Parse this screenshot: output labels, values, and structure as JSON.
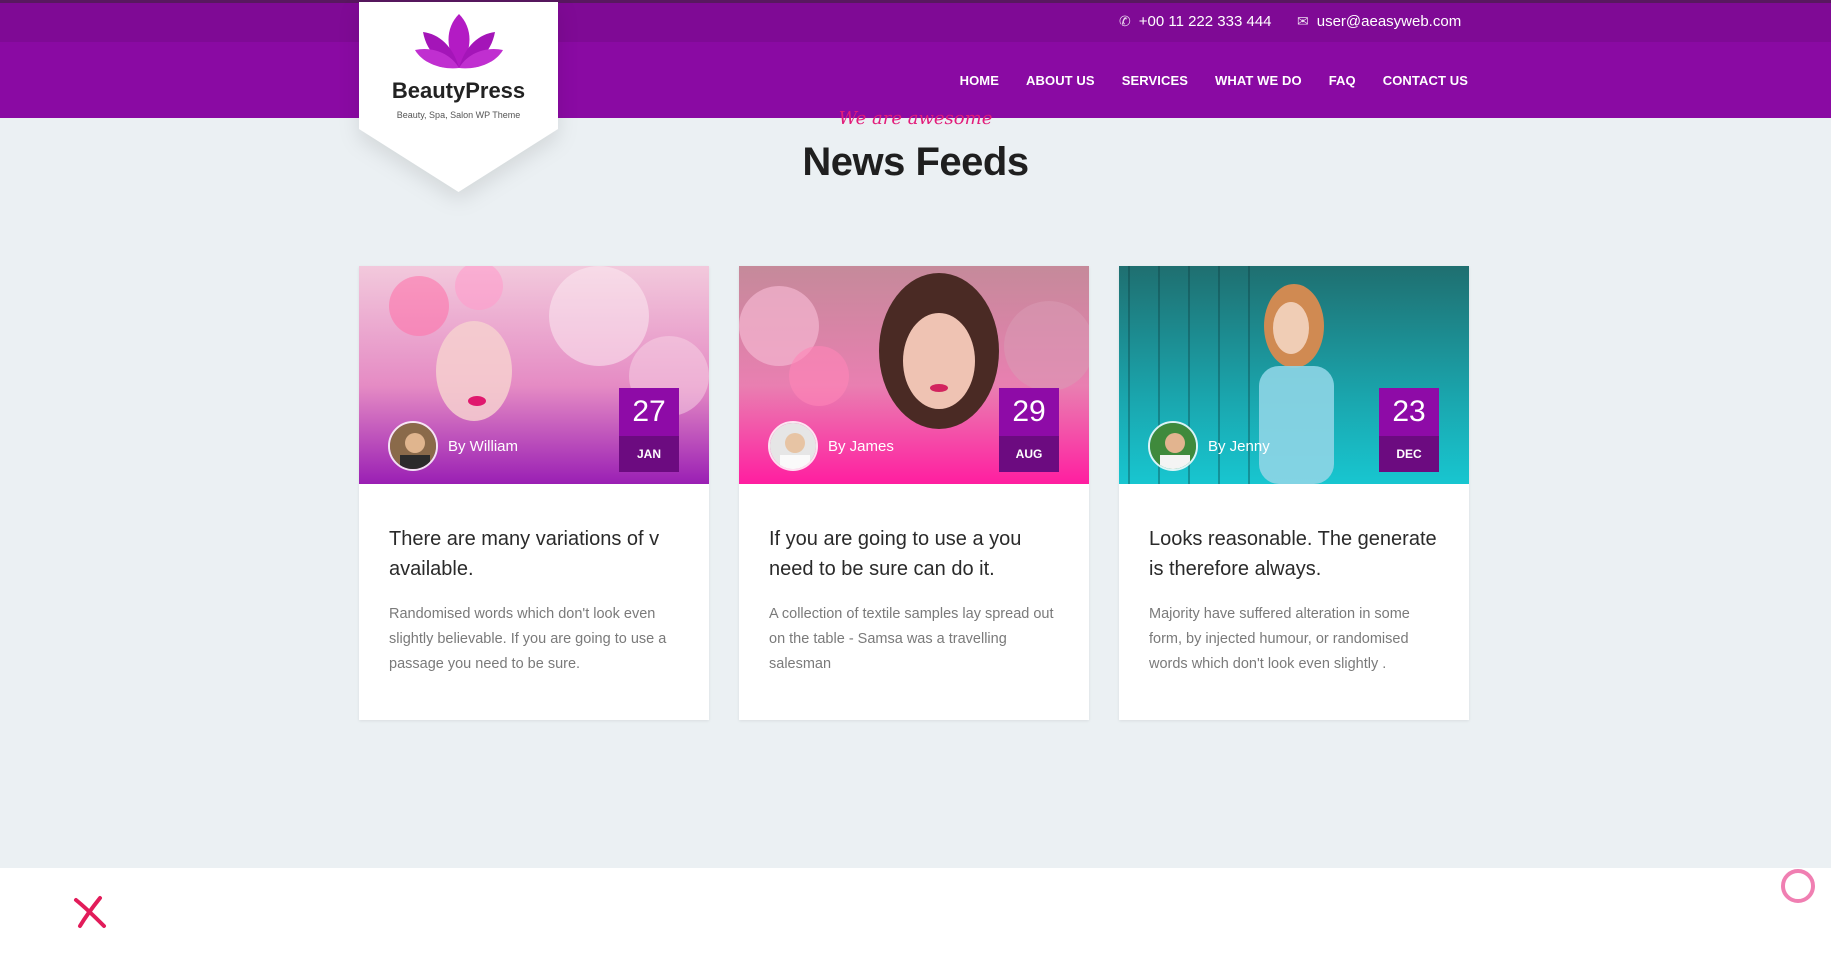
{
  "header": {
    "phone": "+00 11 222 333 444",
    "email": "user@aeasyweb.com",
    "nav": [
      "HOME",
      "ABOUT US",
      "SERVICES",
      "WHAT WE DO",
      "FAQ",
      "CONTACT US"
    ]
  },
  "logo": {
    "title": "BeautyPress",
    "subtitle": "Beauty, Spa, Salon WP Theme"
  },
  "section": {
    "tagline": "We are awesome",
    "title": "News Feeds"
  },
  "posts": [
    {
      "author": "By William",
      "day": "27",
      "month": "JAN",
      "title": "There are many variations of v available.",
      "excerpt": "Randomised words which don't look even slightly believable. If you are going to use a passage you need to be sure."
    },
    {
      "author": "By James",
      "day": "29",
      "month": "AUG",
      "title": "If you are going to use a you need to be sure can do it.",
      "excerpt": "A collection of textile samples lay spread out on the table - Samsa was a travelling salesman"
    },
    {
      "author": "By Jenny",
      "day": "23",
      "month": "DEC",
      "title": "Looks reasonable. The generate is therefore always.",
      "excerpt": "Majority have suffered alteration in some form, by injected humour, or randomised words which don't look even slightly ."
    }
  ],
  "colors": {
    "topbar": "#7f0a95",
    "navbar": "#8a0aa3",
    "accent_pink": "#e21c7a",
    "date_dark": "#6c0b80",
    "date_purple": "#8e0ba7"
  },
  "icons": {
    "phone": "phone-icon",
    "email": "envelope-icon",
    "close": "close-x-icon",
    "back_to_top": "ring-icon"
  }
}
